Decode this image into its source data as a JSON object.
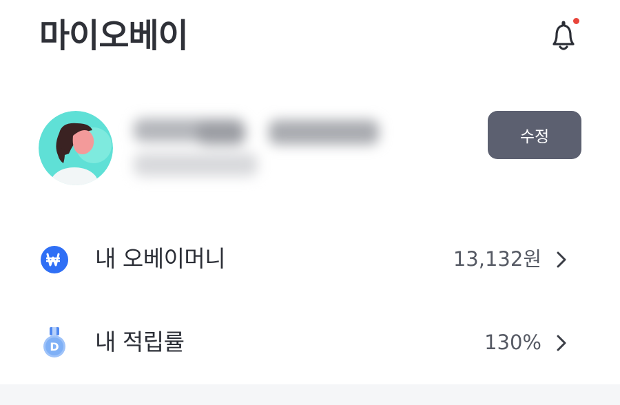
{
  "header": {
    "title": "마이오베이",
    "notification_icon": "bell-icon",
    "has_unread": true,
    "unread_color": "#e8443a"
  },
  "profile": {
    "avatar_icon": "user-avatar",
    "name_redacted": true,
    "edit_label": "수정"
  },
  "menu": [
    {
      "label": "내 오베이머니",
      "value": "13,132원",
      "icon": "won-coin-icon",
      "icon_color": "#2f6ff5"
    },
    {
      "label": "내 적립률",
      "value": "130%",
      "icon": "medal-d-icon",
      "icon_color": "#7fb0f6"
    }
  ],
  "colors": {
    "accent": "#2f6ff5",
    "edit_button_bg": "#5c6070",
    "avatar_bg": "#5fe0d6"
  }
}
